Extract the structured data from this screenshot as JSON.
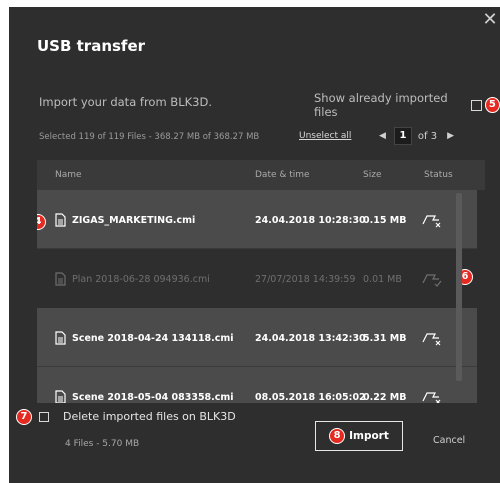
{
  "dialog": {
    "title": "USB transfer",
    "close_symbol": "✕",
    "subtitle": "Import your data from BLK3D.",
    "show_imported_label": "Show already imported files",
    "selection_info": "Selected 119 of 119 Files  -  368.27 MB of 368.27 MB",
    "unselect_all": "Unselect all",
    "pager": {
      "prev": "◀",
      "current": "1",
      "of_text": "of 3",
      "next": "▶"
    }
  },
  "table": {
    "headers": {
      "name": "Name",
      "date": "Date & time",
      "size": "Size",
      "status": "Status"
    },
    "rows": [
      {
        "name": "ZIGAS_MARKETING.cmi",
        "date": "24.04.2018 10:28:30",
        "size": "0.15 MB",
        "state": "selected"
      },
      {
        "name": "Plan 2018-06-28 094936.cmi",
        "date": "27/07/2018 14:39:59",
        "size": "0.01 MB",
        "state": "imported"
      },
      {
        "name": "Scene 2018-04-24 134118.cmi",
        "date": "24.04.2018 13:42:30",
        "size": "5.31 MB",
        "state": "selected"
      },
      {
        "name": "Scene 2018-05-04 083358.cmi",
        "date": "08.05.2018 16:05:02",
        "size": "0.22 MB",
        "state": "selected"
      }
    ]
  },
  "footer": {
    "delete_label": "Delete imported files on BLK3D",
    "delete_info": "4 Files  -  5.70 MB",
    "import_label": "Import",
    "cancel_label": "Cancel"
  },
  "callouts": [
    "4",
    "5",
    "6",
    "7",
    "8"
  ],
  "colors": {
    "callout": "#e52b21",
    "dialog_bg": "#2e2e2e",
    "row_selected": "#4b4b4b",
    "row_imported": "#2e2e2e"
  }
}
